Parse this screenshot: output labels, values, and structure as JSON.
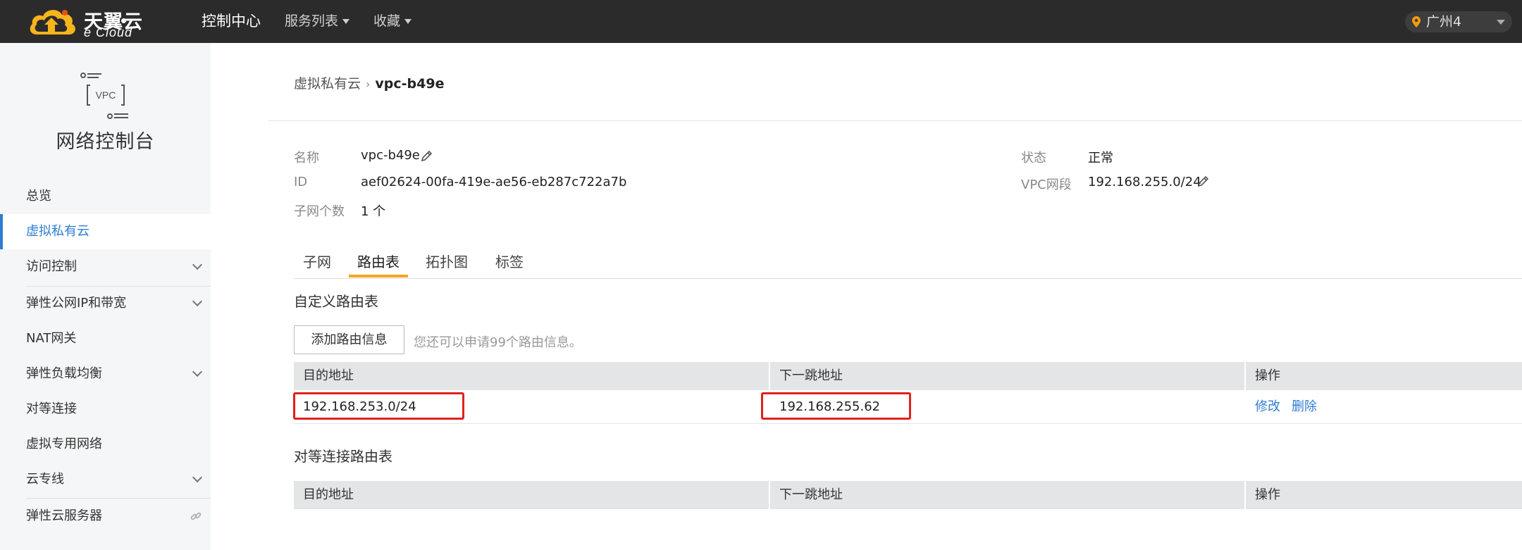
{
  "topbar": {
    "logo_cn": "天翼云",
    "logo_en": "e Cloud",
    "nav": [
      {
        "label": "控制中心",
        "dropdown": false
      },
      {
        "label": "服务列表",
        "dropdown": true
      },
      {
        "label": "收藏",
        "dropdown": true
      }
    ],
    "region": "广州4"
  },
  "sidebar": {
    "icon_label": "VPC",
    "title": "网络控制台",
    "items": [
      {
        "label": "总览"
      },
      {
        "label": "虚拟私有云",
        "active": true
      },
      {
        "label": "访问控制",
        "expandable": true
      },
      {
        "label": "弹性公网IP和带宽",
        "expandable": true
      },
      {
        "label": "NAT网关"
      },
      {
        "label": "弹性负载均衡",
        "expandable": true
      },
      {
        "label": "对等连接"
      },
      {
        "label": "虚拟专用网络"
      },
      {
        "label": "云专线",
        "expandable": true
      },
      {
        "label": "弹性云服务器",
        "link_icon": "link-icon"
      }
    ]
  },
  "breadcrumb": {
    "parent": "虚拟私有云",
    "separator": "›",
    "current": "vpc-b49e"
  },
  "info": {
    "name_label": "名称",
    "name_value": "vpc-b49e",
    "id_label": "ID",
    "id_value": "aef02624-00fa-419e-ae56-eb287c722a7b",
    "subnets_label": "子网个数",
    "subnets_value": "1 个",
    "status_label": "状态",
    "status_value": "正常",
    "cidr_label": "VPC网段",
    "cidr_value": "192.168.255.0/24"
  },
  "tabs": [
    {
      "label": "子网"
    },
    {
      "label": "路由表",
      "active": true
    },
    {
      "label": "拓扑图"
    },
    {
      "label": "标签"
    }
  ],
  "custom_routes": {
    "title": "自定义路由表",
    "add_button": "添加路由信息",
    "hint": "您还可以申请99个路由信息。",
    "columns": [
      "目的地址",
      "下一跳地址",
      "操作"
    ],
    "rows": [
      {
        "destination": "192.168.253.0/24",
        "next_hop": "192.168.255.62",
        "actions": [
          "修改",
          "删除"
        ]
      }
    ]
  },
  "peering_routes": {
    "title": "对等连接路由表",
    "columns": [
      "目的地址",
      "下一跳地址",
      "操作"
    ]
  },
  "colors": {
    "accent": "#2d7dd2",
    "tab_underline": "#f5a623",
    "highlight": "#e0201c",
    "topbar": "#2b2b2b"
  }
}
